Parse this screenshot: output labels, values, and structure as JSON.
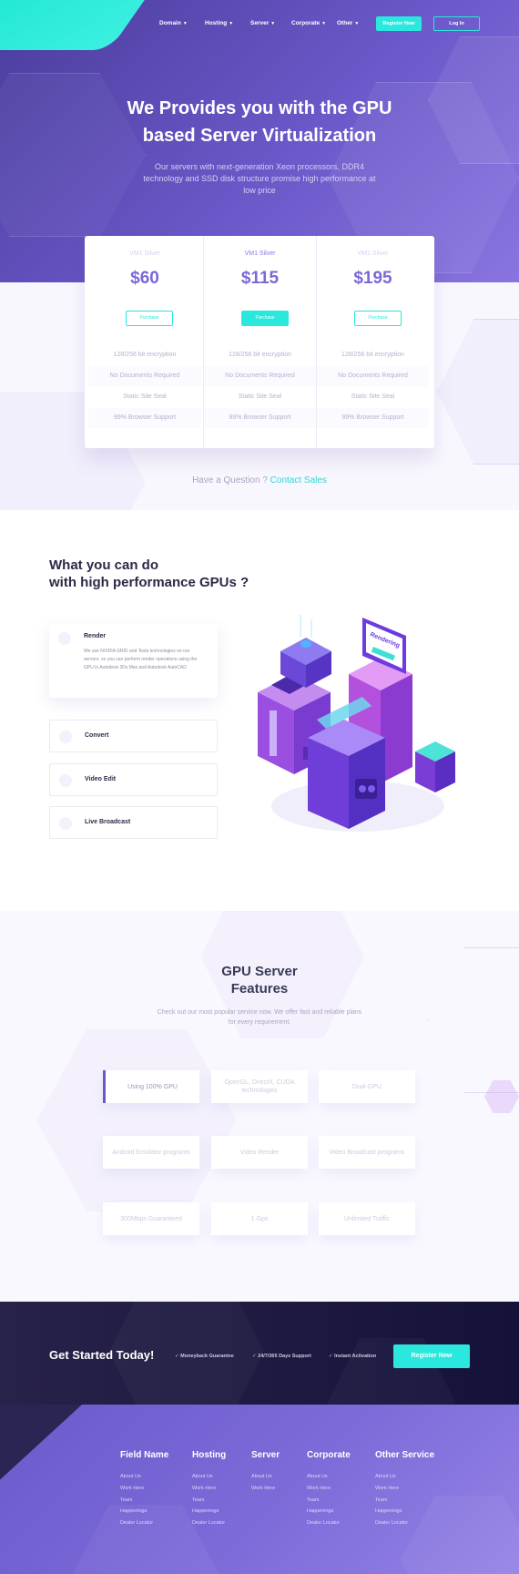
{
  "nav": {
    "items": [
      {
        "label": "Domain"
      },
      {
        "label": "Hosting"
      },
      {
        "label": "Server"
      },
      {
        "label": "Corporate"
      },
      {
        "label": "Other"
      }
    ],
    "register_label": "Register Now",
    "login_label": "Log In"
  },
  "hero": {
    "title_line1": "We Provides you with the GPU",
    "title_line2": "based Server Virtualization",
    "subtitle": "Our servers with next-generation Xeon processors, DDR4 technology and SSD disk structure promise high performance at low price"
  },
  "pricing": {
    "plans": [
      {
        "name": "VM1 Silver",
        "price": "$60",
        "button": "Purchase"
      },
      {
        "name": "VM1 Silver",
        "price": "$115",
        "button": "Purchase"
      },
      {
        "name": "VM1 Silver",
        "price": "$195",
        "button": "Purchase"
      }
    ],
    "features": [
      "128/256 bit encryption",
      "No Documents Required",
      "Static Site Seal",
      "99% Browser Support"
    ],
    "question": "Have a Question ?",
    "contact_link": "Contact Sales"
  },
  "what_you_can_do": {
    "title_line1": "What you can do",
    "title_line2": "with high performance GPUs ?",
    "items": [
      {
        "title": "Render",
        "description": "We use NVIDIA GRID and Tesla technologies on our servers, so you can perform render operations using the GPU in Autodesk 3Ds Max and Autodesk AutoCAD"
      },
      {
        "title": "Convert"
      },
      {
        "title": "Video Edit"
      },
      {
        "title": "Live Broadcast"
      }
    ],
    "illustration_label": "Rendering"
  },
  "gpu_features": {
    "title_line1": "GPU Server",
    "title_line2": "Features",
    "subtitle": "Check out our most popular service now. We offer fast and reliable plans for every requirement.",
    "items": [
      "Using 100% GPU",
      "OpenGL, DirectX, CUDA technologies",
      "Dual-GPU",
      "Android Emulator programs",
      "Video Render",
      "Video Broadcast programs",
      "300Mbps Guaranteed",
      "1 Gps",
      "Unlimited Traffic"
    ]
  },
  "cta": {
    "title": "Get Started Today!",
    "checks": [
      "Moneyback Guarantee",
      "24/7/365 Days Support",
      "Instant Activation"
    ],
    "button": "Register Now"
  },
  "footer": {
    "columns": [
      {
        "heading": "Field Name",
        "links": [
          "About Us",
          "Work Here",
          "Team",
          "Happenings",
          "Dealer Locator"
        ]
      },
      {
        "heading": "Hosting",
        "links": [
          "About Us",
          "Work Here",
          "Team",
          "Happenings",
          "Dealer Locator"
        ]
      },
      {
        "heading": "Server",
        "links": [
          "About Us",
          "Work Here"
        ]
      },
      {
        "heading": "Corporate",
        "links": [
          "About Us",
          "Work Here",
          "Team",
          "Happenings",
          "Dealer Locator"
        ]
      },
      {
        "heading": "Other Service",
        "links": [
          "About Us",
          "Work Here",
          "Team",
          "Happenings",
          "Dealer Locator"
        ]
      }
    ]
  },
  "colors": {
    "accent": "#2ae8dd",
    "primary": "#6b58c9",
    "dark": "#1c1840"
  }
}
